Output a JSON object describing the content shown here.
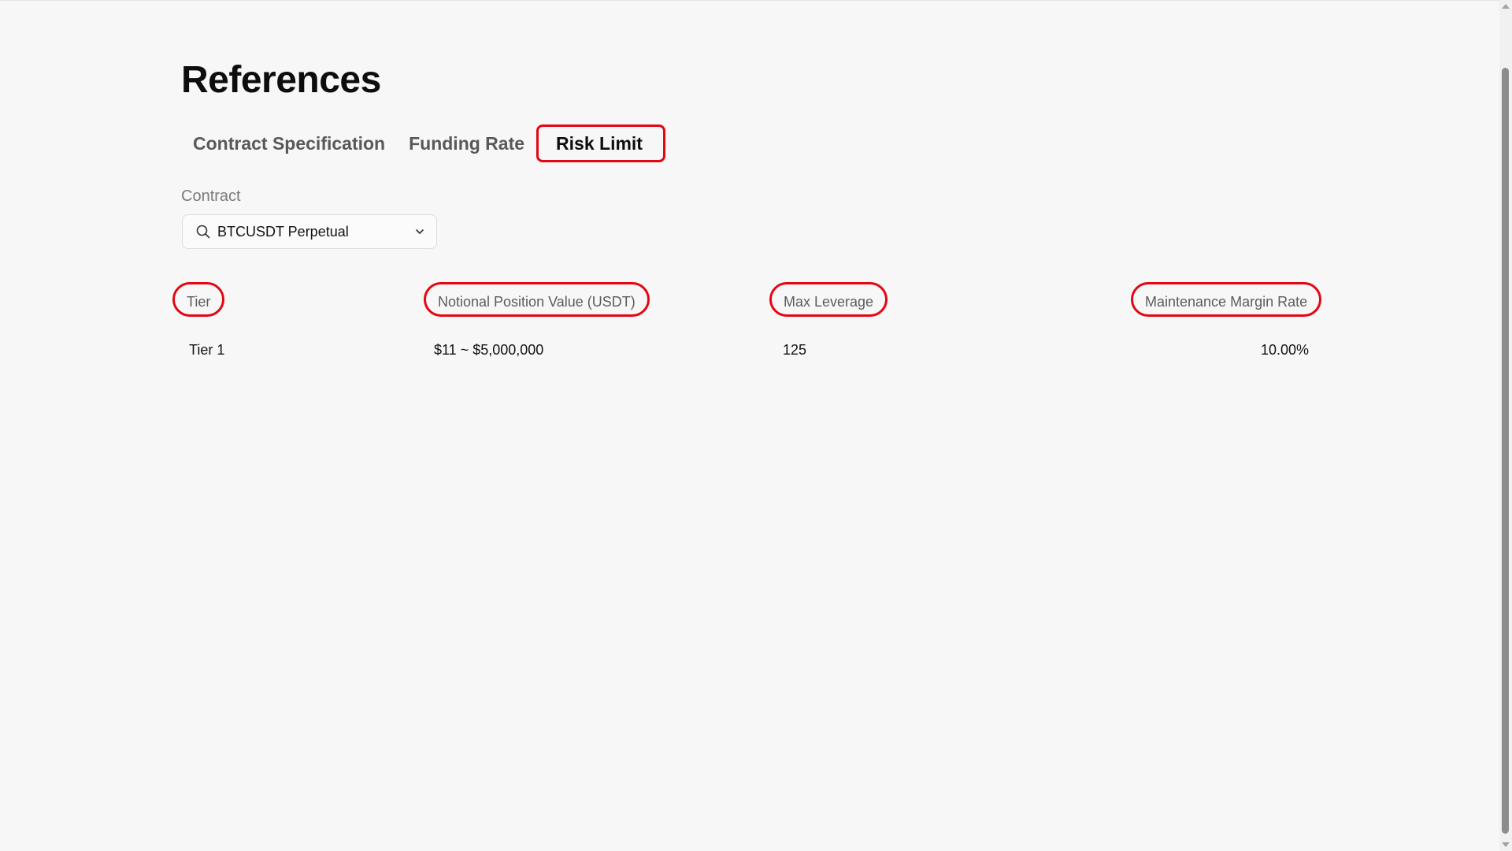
{
  "page": {
    "title": "References"
  },
  "tabs": [
    {
      "label": "Contract Specification",
      "active": false
    },
    {
      "label": "Funding Rate",
      "active": false
    },
    {
      "label": "Risk Limit",
      "active": true
    }
  ],
  "contract_field": {
    "label": "Contract",
    "value": "BTCUSDT Perpetual",
    "icon": "search-icon",
    "dropdown_icon": "chevron-down-icon"
  },
  "table": {
    "headers": [
      "Tier",
      "Notional Position Value (USDT)",
      "Max Leverage",
      "Maintenance Margin Rate"
    ],
    "rows": [
      [
        "Tier 1",
        "$11 ~ $5,000,000",
        "125",
        "10.00%"
      ]
    ]
  },
  "colors": {
    "highlight": "#e30613",
    "background": "#f7f7f7"
  }
}
